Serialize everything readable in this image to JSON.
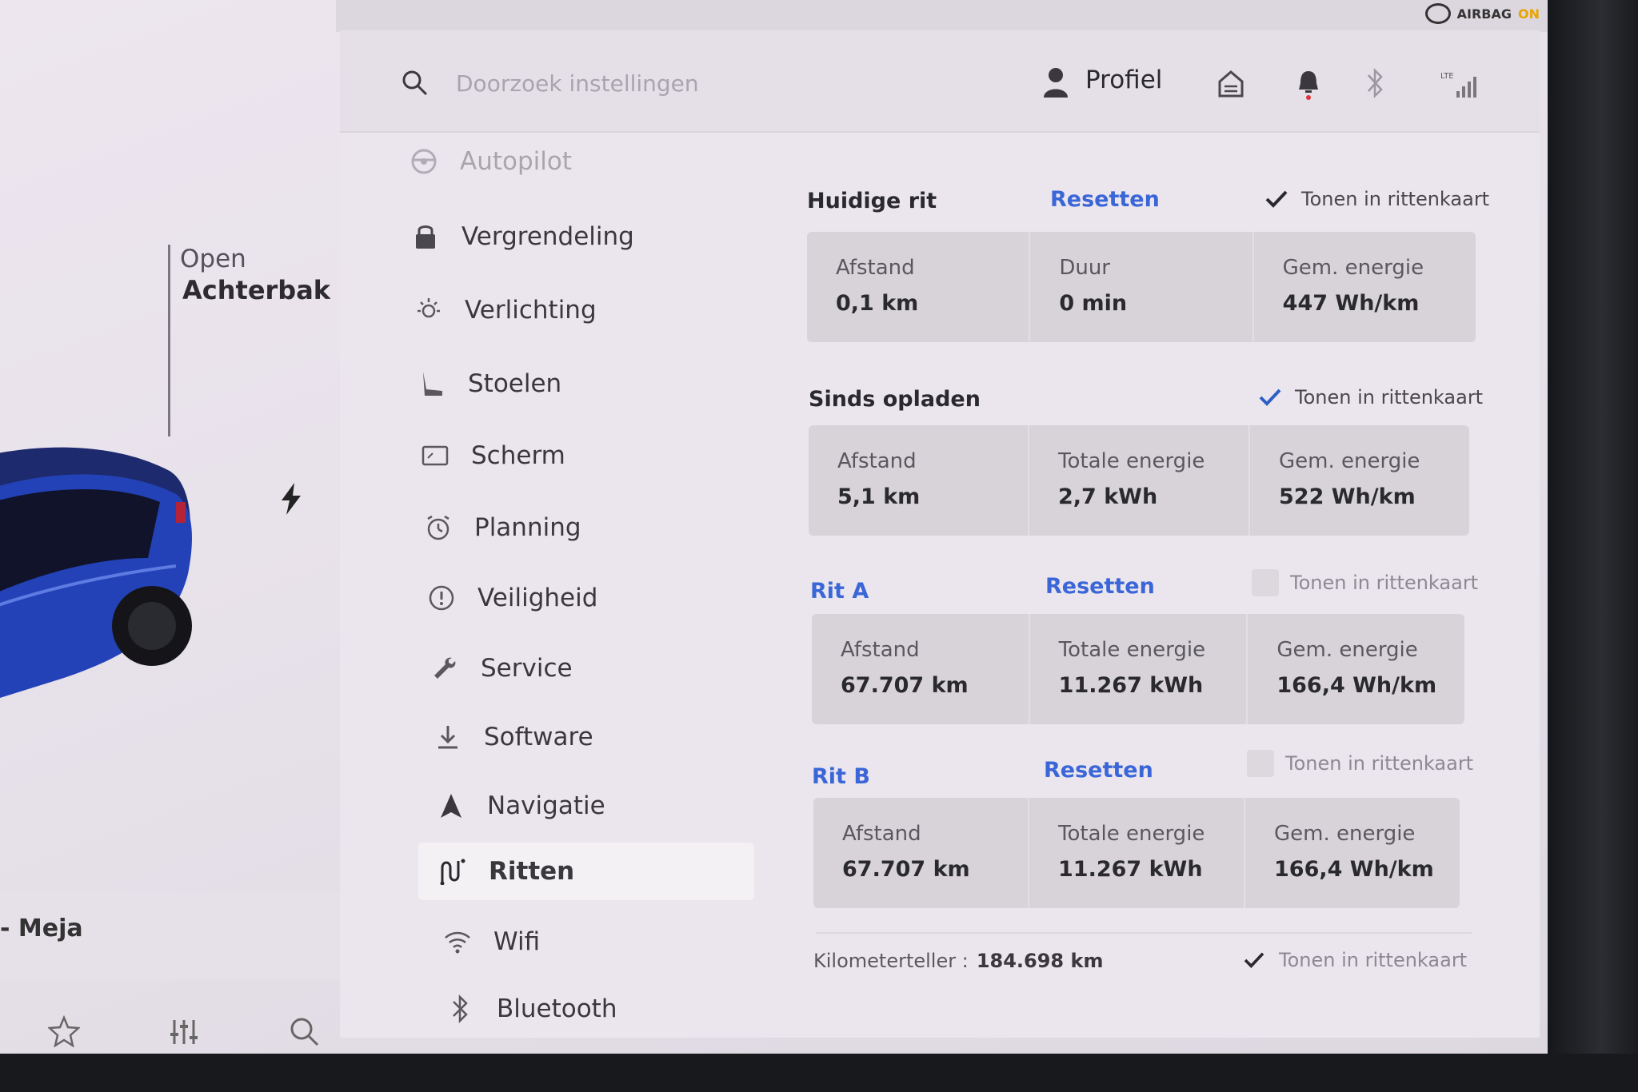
{
  "status": {
    "airbag_label": "AIRBAG",
    "airbag_state": "ON"
  },
  "car": {
    "trunk_open_label": "Open",
    "trunk_name": "Achterbak",
    "name": "- Meja",
    "colors": {
      "body": "#1f3fae",
      "accent": "#e9a400"
    }
  },
  "header": {
    "search_placeholder": "Doorzoek instellingen",
    "profile_label": "Profiel",
    "lte_label": "LTE"
  },
  "menu": {
    "items": [
      {
        "label": "Autopilot",
        "icon": "steering-wheel-icon"
      },
      {
        "label": "Vergrendeling",
        "icon": "lock-icon"
      },
      {
        "label": "Verlichting",
        "icon": "light-bulb-icon"
      },
      {
        "label": "Stoelen",
        "icon": "seat-icon"
      },
      {
        "label": "Scherm",
        "icon": "display-icon"
      },
      {
        "label": "Planning",
        "icon": "alarm-clock-icon"
      },
      {
        "label": "Veiligheid",
        "icon": "alert-circle-icon"
      },
      {
        "label": "Service",
        "icon": "wrench-icon"
      },
      {
        "label": "Software",
        "icon": "download-icon"
      },
      {
        "label": "Navigatie",
        "icon": "navigation-arrow-icon"
      },
      {
        "label": "Ritten",
        "icon": "trips-icon"
      },
      {
        "label": "Wifi",
        "icon": "wifi-icon"
      },
      {
        "label": "Bluetooth",
        "icon": "bluetooth-icon"
      }
    ],
    "active": "Ritten"
  },
  "trips": {
    "current": {
      "title": "Huidige rit",
      "reset_label": "Resetten",
      "toggle_label": "Tonen in rittenkaart",
      "toggle_checked": true,
      "stats": [
        {
          "label": "Afstand",
          "value": "0,1 km"
        },
        {
          "label": "Duur",
          "value": "0 min"
        },
        {
          "label": "Gem. energie",
          "value": "447 Wh/km"
        }
      ]
    },
    "since_charge": {
      "title": "Sinds opladen",
      "toggle_label": "Tonen in rittenkaart",
      "toggle_checked": true,
      "stats": [
        {
          "label": "Afstand",
          "value": "5,1 km"
        },
        {
          "label": "Totale energie",
          "value": "2,7 kWh"
        },
        {
          "label": "Gem. energie",
          "value": "522 Wh/km"
        }
      ]
    },
    "trip_a": {
      "title": "Rit A",
      "reset_label": "Resetten",
      "toggle_label": "Tonen in rittenkaart",
      "toggle_checked": false,
      "stats": [
        {
          "label": "Afstand",
          "value": "67.707 km"
        },
        {
          "label": "Totale energie",
          "value": "11.267 kWh"
        },
        {
          "label": "Gem. energie",
          "value": "166,4 Wh/km"
        }
      ]
    },
    "trip_b": {
      "title": "Rit B",
      "reset_label": "Resetten",
      "toggle_label": "Tonen in rittenkaart",
      "toggle_checked": false,
      "stats": [
        {
          "label": "Afstand",
          "value": "67.707 km"
        },
        {
          "label": "Totale energie",
          "value": "11.267 kWh"
        },
        {
          "label": "Gem. energie",
          "value": "166,4 Wh/km"
        }
      ]
    },
    "odometer": {
      "label": "Kilometerteller :",
      "value": "184.698 km",
      "toggle_label": "Tonen in rittenkaart",
      "toggle_checked": true
    }
  }
}
